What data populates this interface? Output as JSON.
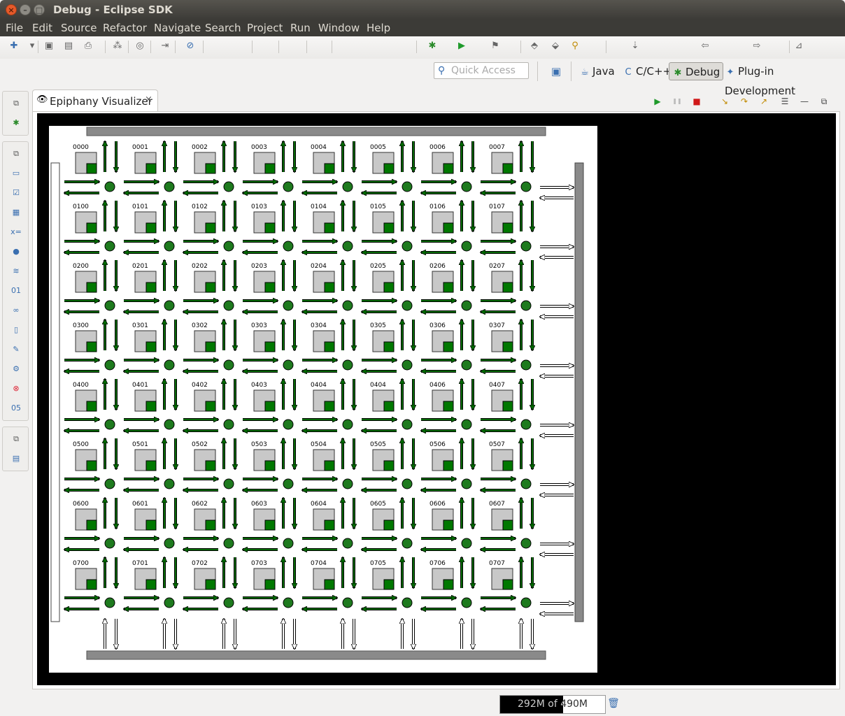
{
  "window": {
    "title": "Debug - Eclipse SDK",
    "close_glyph": "×",
    "min_glyph": "–",
    "max_glyph": "□"
  },
  "menu": [
    "File",
    "Edit",
    "Source",
    "Refactor",
    "Navigate",
    "Search",
    "Project",
    "Run",
    "Window",
    "Help"
  ],
  "toolbar": {
    "icons": [
      "new-wizard-icon",
      "dropdown-icon",
      "save-icon",
      "save-all-icon",
      "print-icon",
      "binary-icon",
      "target-icon",
      "step-filter-icon",
      "skip-breakpoints-icon",
      "debug-icon",
      "run-icon",
      "external-tools-icon",
      "open-type-icon",
      "open-task-icon",
      "search-icon",
      "next-annotation-icon",
      "back-icon",
      "forward-icon",
      "pin-icon"
    ]
  },
  "quick_access": {
    "placeholder": "Quick Access"
  },
  "perspectives": [
    {
      "label": "Java",
      "icon": "java-perspective-icon",
      "active": false
    },
    {
      "label": "C/C++",
      "icon": "cpp-perspective-icon",
      "active": false
    },
    {
      "label": "Debug",
      "icon": "debug-perspective-icon",
      "active": true
    },
    {
      "label": "Plug-in Development",
      "icon": "plugin-perspective-icon",
      "active": false
    }
  ],
  "editor_tab": {
    "label": "Epiphany Visualizer",
    "icon": "eye-icon",
    "close_glyph": "×"
  },
  "view_toolbar": [
    "resume-icon",
    "suspend-icon",
    "terminate-icon",
    "step-into-icon",
    "step-over-icon",
    "step-return-icon",
    "view-menu-icon",
    "minimize-icon",
    "maximize-icon"
  ],
  "left_trim": {
    "groups": [
      [
        "restore-icon",
        "debug-view-icon"
      ],
      [
        "restore-icon",
        "console-icon",
        "tasks-icon",
        "modules-icon",
        "variables-icon",
        "breakpoints-icon",
        "expressions-icon",
        "memory-icon",
        "registers-icon",
        "disassembly-icon",
        "signals-icon",
        "executables-icon",
        "problems-icon",
        "os-resources-icon"
      ],
      [
        "restore-icon",
        "outline-icon"
      ]
    ]
  },
  "grid": {
    "rows": 8,
    "cols": 8,
    "core_labels": [
      [
        "0000",
        "0001",
        "0002",
        "0003",
        "0004",
        "0005",
        "0006",
        "0007"
      ],
      [
        "0100",
        "0101",
        "0102",
        "0103",
        "0104",
        "0105",
        "0106",
        "0107"
      ],
      [
        "0200",
        "0201",
        "0202",
        "0203",
        "0204",
        "0205",
        "0206",
        "0207"
      ],
      [
        "0300",
        "0301",
        "0302",
        "0303",
        "0304",
        "0305",
        "0306",
        "0307"
      ],
      [
        "0400",
        "0401",
        "0402",
        "0403",
        "0404",
        "0404",
        "0406",
        "0407"
      ],
      [
        "0500",
        "0501",
        "0502",
        "0503",
        "0504",
        "0505",
        "0506",
        "0507"
      ],
      [
        "0600",
        "0601",
        "0602",
        "0603",
        "0604",
        "0605",
        "0606",
        "0607"
      ],
      [
        "0700",
        "0701",
        "0702",
        "0703",
        "0704",
        "0705",
        "0706",
        "0707"
      ]
    ],
    "colors": {
      "link": "#006a00",
      "router": "#1e7a1e",
      "core": "#c8c8c8",
      "core_active": "#007800",
      "edge_bar": "#8a8a8a",
      "outer_link": "#ffffff"
    }
  },
  "status": {
    "heap_text": "292M of 490M",
    "heap_used_fraction": 0.6,
    "gc_icon": "trash-icon"
  }
}
